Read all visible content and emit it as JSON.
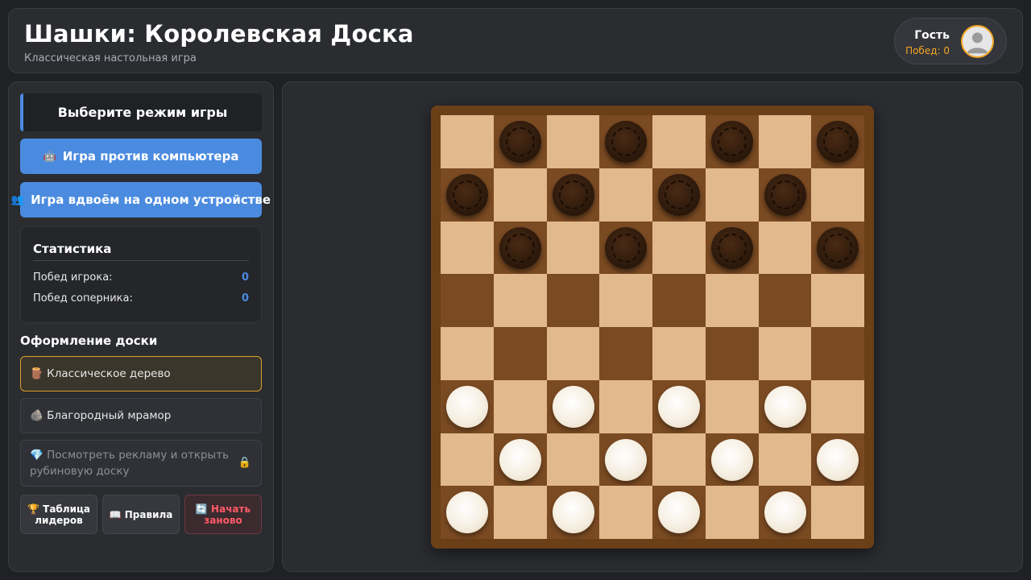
{
  "header": {
    "title": "Шашки: Королевская Доска",
    "subtitle": "Классическая настольная игра",
    "user": {
      "name": "Гость",
      "wins": "Побед: 0"
    }
  },
  "sidebar": {
    "mode_header": "Выберите режим игры",
    "mode_buttons": [
      {
        "icon": "🤖",
        "label": "Игра против компьютера"
      },
      {
        "icon": "👥",
        "label": "Игра вдвоём на одном устройстве"
      }
    ],
    "stats": {
      "title": "Статистика",
      "rows": [
        {
          "label": "Побед игрока:",
          "value": "0"
        },
        {
          "label": "Побед соперника:",
          "value": "0"
        }
      ]
    },
    "design_title": "Оформление доски",
    "themes": [
      {
        "icon": "🪵",
        "label": "Классическое дерево",
        "active": true,
        "locked": false
      },
      {
        "icon": "🪨",
        "label": "Благородный мрамор",
        "active": false,
        "locked": false
      },
      {
        "icon": "💎",
        "label": "Посмотреть рекламу и открыть рубиновую доску",
        "active": false,
        "locked": true,
        "lock_icon": "🔒"
      }
    ],
    "buttons": {
      "leaderboard": {
        "icon": "🏆",
        "label": "Таблица лидеров"
      },
      "rules": {
        "icon": "📖",
        "label": "Правила"
      },
      "restart": {
        "icon": "🔄",
        "label": "Начать заново"
      }
    }
  },
  "board": {
    "size": 8,
    "colors": {
      "light": "#e2b98d",
      "dark": "#7a4a22",
      "frame": "#6b3f17"
    },
    "pieces": [
      "-b-b-b-b",
      "b-b-b-b-",
      "-b-b-b-b",
      "--------",
      "--------",
      "w-w-w-w-",
      "-w-w-w-w",
      "w-w-w-w-"
    ]
  }
}
